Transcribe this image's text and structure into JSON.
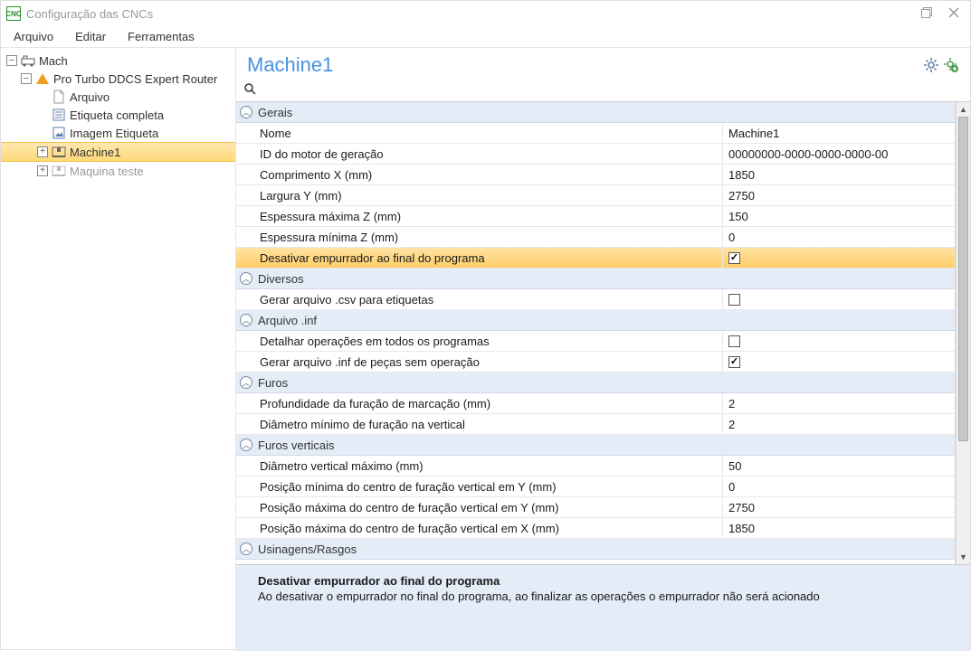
{
  "window": {
    "title": "Configuração das CNCs"
  },
  "menu": {
    "items": [
      "Arquivo",
      "Editar",
      "Ferramentas"
    ]
  },
  "tree": {
    "root": "Mach",
    "node1": "Pro Turbo DDCS Expert Router",
    "items": [
      "Arquivo",
      "Etiqueta completa",
      "Imagem Etiqueta",
      "Machine1",
      "Maquina teste"
    ],
    "selected": "Machine1"
  },
  "panel": {
    "title": "Machine1"
  },
  "categories": {
    "gerais": "Gerais",
    "diversos": "Diversos",
    "arquivo_inf": "Arquivo .inf",
    "furos": "Furos",
    "furos_verticais": "Furos verticais",
    "usinagens": "Usinagens/Rasgos"
  },
  "props": {
    "gerais": {
      "nome": {
        "label": "Nome",
        "value": "Machine1"
      },
      "id_motor": {
        "label": "ID do motor de geração",
        "value": "00000000-0000-0000-0000-00"
      },
      "comp_x": {
        "label": "Comprimento X (mm)",
        "value": "1850"
      },
      "larg_y": {
        "label": "Largura Y (mm)",
        "value": "2750"
      },
      "esp_max_z": {
        "label": "Espessura máxima Z (mm)",
        "value": "150"
      },
      "esp_min_z": {
        "label": "Espessura mínima Z (mm)",
        "value": "0"
      },
      "desativar_emp": {
        "label": "Desativar empurrador ao final do programa",
        "checked": true
      }
    },
    "diversos": {
      "gerar_csv": {
        "label": "Gerar arquivo .csv para etiquetas",
        "checked": false
      }
    },
    "arquivo_inf": {
      "detalhar": {
        "label": "Detalhar operações em todos os programas",
        "checked": false
      },
      "gerar_inf": {
        "label": "Gerar arquivo .inf de peças sem operação",
        "checked": true
      }
    },
    "furos": {
      "profundidade": {
        "label": "Profundidade da furação de marcação (mm)",
        "value": "2"
      },
      "diametro_min_vert": {
        "label": "Diâmetro mínimo de furação na vertical",
        "value": "2"
      }
    },
    "furos_verticais": {
      "diametro_vert_max": {
        "label": "Diâmetro vertical máximo (mm)",
        "value": "50"
      },
      "pos_min_y": {
        "label": "Posição mínima do centro de furação vertical em Y (mm)",
        "value": "0"
      },
      "pos_max_y": {
        "label": "Posição máxima do centro de furação vertical em Y (mm)",
        "value": "2750"
      },
      "pos_max_x": {
        "label": "Posição máxima do centro de furação vertical em X (mm)",
        "value": "1850"
      }
    }
  },
  "description": {
    "title": "Desativar empurrador ao final do programa",
    "body": "Ao desativar o empurrador no final do programa, ao finalizar as operações o empurrador não será acionado"
  }
}
